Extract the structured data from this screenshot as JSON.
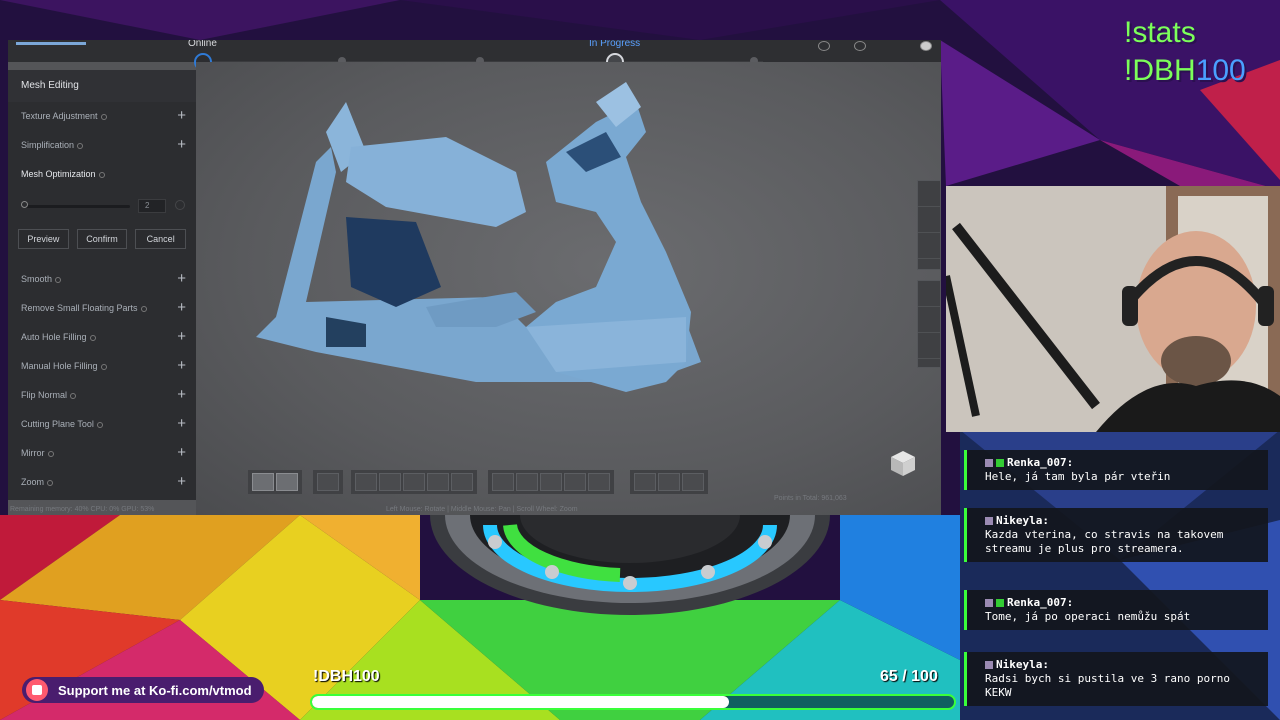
{
  "stream": {
    "stats_cmd": "!stats",
    "dbh_cmd_prefix": "!DBH",
    "dbh_cmd_num": "100",
    "kofi_text": "Support me at Ko-fi.com/vtmod",
    "goal_label": "!DBH100",
    "goal_current": "65",
    "goal_total": "/ 100",
    "goal_fraction": 0.65
  },
  "app": {
    "status_left": "Online",
    "status_mid": "In Progress",
    "panel_title": "Mesh Editing",
    "tools": [
      {
        "label": "Texture Adjustment"
      },
      {
        "label": "Simplification"
      },
      {
        "label": "Mesh Optimization"
      },
      {
        "label": "Smooth"
      },
      {
        "label": "Remove Small Floating Parts"
      },
      {
        "label": "Auto Hole Filling"
      },
      {
        "label": "Manual Hole Filling"
      },
      {
        "label": "Flip Normal"
      },
      {
        "label": "Cutting Plane Tool"
      },
      {
        "label": "Mirror"
      },
      {
        "label": "Zoom"
      }
    ],
    "slider_value": "2",
    "btn_preview": "Preview",
    "btn_confirm": "Confirm",
    "btn_cancel": "Cancel",
    "status_memory": "Remaining memory: 40% CPU: 0% GPU: 53%",
    "status_controls": "Left Mouse: Rotate | Middle Mouse: Pan | Scroll Wheel: Zoom",
    "points_total": "Points in Total: 961,063"
  },
  "chat": [
    {
      "user": "Renka_007:",
      "text": "Hele, já tam byla pár vteřin"
    },
    {
      "user": "Nikeyla:",
      "text": "Kazda vterina, co stravis na takovem streamu je plus pro streamera."
    },
    {
      "user": "Renka_007:",
      "text": "Tome, já po operaci nemůžu spát"
    },
    {
      "user": "Nikeyla:",
      "text": "Radsi bych si pustila ve 3 rano porno KEKW"
    }
  ]
}
